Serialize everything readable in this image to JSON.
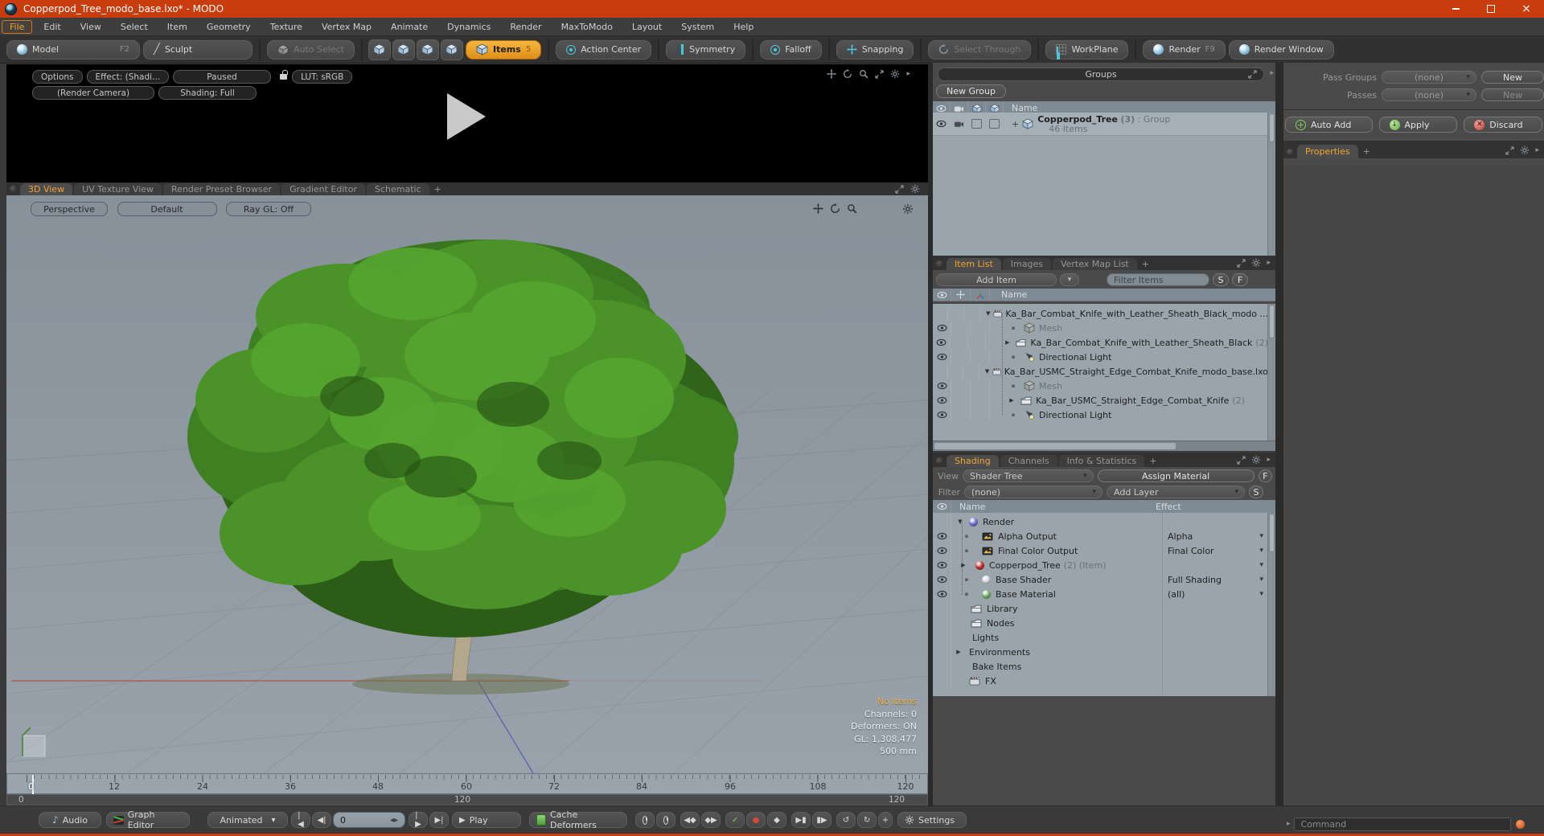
{
  "window": {
    "title": "Copperpod_Tree_modo_base.lxo* - MODO"
  },
  "menubar": {
    "items": [
      "File",
      "Edit",
      "View",
      "Select",
      "Item",
      "Geometry",
      "Texture",
      "Vertex Map",
      "Animate",
      "Dynamics",
      "Render",
      "MaxToModo",
      "Layout",
      "System",
      "Help"
    ]
  },
  "toolbar": {
    "model": "Model",
    "model_key": "F2",
    "sculpt": "Sculpt",
    "auto_select": "Auto Select",
    "items": "Items",
    "items_key": "5",
    "action_center": "Action Center",
    "symmetry": "Symmetry",
    "falloff": "Falloff",
    "snapping": "Snapping",
    "select_through": "Select Through",
    "workplane": "WorkPlane",
    "render": "Render",
    "render_key": "F9",
    "render_window": "Render Window"
  },
  "preview": {
    "options": "Options",
    "effect": "Effect: (Shadi...",
    "paused": "Paused",
    "lut": "LUT: sRGB",
    "camera": "(Render Camera)",
    "shading": "Shading: Full"
  },
  "viewport_tabs": {
    "tabs": [
      "3D View",
      "UV Texture View",
      "Render Preset Browser",
      "Gradient Editor",
      "Schematic"
    ],
    "add_tab": "+"
  },
  "viewport": {
    "perspective": "Perspective",
    "default": "Default",
    "raygl": "Ray GL: Off",
    "info": [
      "No Items",
      "Channels: 0",
      "Deformers: ON",
      "GL: 1,308,477",
      "500 mm"
    ]
  },
  "timeline": {
    "ticks": [
      "0",
      "12",
      "24",
      "36",
      "48",
      "60",
      "72",
      "84",
      "96",
      "108",
      "120"
    ],
    "current": "0",
    "range_start": "0",
    "range_mid": "120",
    "range_end": "120"
  },
  "transport": {
    "audio": "Audio",
    "graph_editor": "Graph Editor",
    "animated": "Animated",
    "frame": "0",
    "play": "Play",
    "cache_deformers": "Cache Deformers",
    "settings": "Settings"
  },
  "groups_panel": {
    "title": "Groups",
    "new_group": "New Group",
    "name_col": "Name",
    "row": {
      "expand": "+",
      "name": "Copperpod_Tree",
      "count": "(3)",
      "type": ": Group",
      "items": "46 Items"
    }
  },
  "item_list_panel": {
    "tabs": [
      "Item List",
      "Images",
      "Vertex Map List"
    ],
    "add_tab": "+",
    "add_item": "Add Item",
    "filter_placeholder": "Filter Items",
    "s": "S",
    "f": "F",
    "name_col": "Name",
    "rows": [
      {
        "label": "Ka_Bar_Combat_Knife_with_Leather_Sheath_Black_modo ...",
        "count": ""
      },
      {
        "label": "Mesh",
        "count": ""
      },
      {
        "label": "Ka_Bar_Combat_Knife_with_Leather_Sheath_Black",
        "count": "(2)"
      },
      {
        "label": "Directional Light",
        "count": ""
      },
      {
        "label": "Ka_Bar_USMC_Straight_Edge_Combat_Knife_modo_base.lxo",
        "count": ""
      },
      {
        "label": "Mesh",
        "count": ""
      },
      {
        "label": "Ka_Bar_USMC_Straight_Edge_Combat_Knife",
        "count": "(2)"
      },
      {
        "label": "Directional Light",
        "count": ""
      }
    ]
  },
  "shading_panel": {
    "tabs": [
      "Shading",
      "Channels",
      "Info & Statistics"
    ],
    "add_tab": "+",
    "view_label": "View",
    "view_value": "Shader Tree",
    "assign_material": "Assign Material",
    "f": "F",
    "filter_label": "Filter",
    "filter_value": "(none)",
    "add_layer": "Add Layer",
    "s": "S",
    "name_col": "Name",
    "effect_col": "Effect",
    "rows": [
      {
        "name": "Render",
        "suffix": "",
        "effect": ""
      },
      {
        "name": "Alpha Output",
        "suffix": "",
        "effect": "Alpha"
      },
      {
        "name": "Final Color Output",
        "suffix": "",
        "effect": "Final Color"
      },
      {
        "name": "Copperpod_Tree",
        "suffix": "(2) (Item)",
        "effect": ""
      },
      {
        "name": "Base Shader",
        "suffix": "",
        "effect": "Full Shading"
      },
      {
        "name": "Base Material",
        "suffix": "",
        "effect": "(all)"
      },
      {
        "name": "Library",
        "suffix": "",
        "effect": ""
      },
      {
        "name": "Nodes",
        "suffix": "",
        "effect": ""
      },
      {
        "name": "Lights",
        "suffix": "",
        "effect": ""
      },
      {
        "name": "Environments",
        "suffix": "",
        "effect": ""
      },
      {
        "name": "Bake Items",
        "suffix": "",
        "effect": ""
      },
      {
        "name": "FX",
        "suffix": "",
        "effect": ""
      }
    ]
  },
  "passes_panel": {
    "pass_groups_label": "Pass Groups",
    "pass_groups_value": "(none)",
    "pass_groups_new": "New",
    "passes_label": "Passes",
    "passes_value": "(none)",
    "passes_new": "New",
    "auto_add": "Auto Add",
    "apply": "Apply",
    "discard": "Discard"
  },
  "properties_panel": {
    "tab": "Properties",
    "add_tab": "+"
  },
  "command_bar": {
    "placeholder": "Command"
  },
  "colors": {
    "titlebar": "#c93c0e",
    "accent_orange": "#f0a434",
    "items_button": "#e89b20",
    "cyan": "#4cc6dd",
    "viewport_bg": "#8f99a2",
    "list_bg": "#9aa4ab",
    "header_row": "#7e8a94",
    "panel_bg": "#4a4a4a",
    "canopy_green": "#3f8022",
    "trunk": "#b3a78c"
  }
}
